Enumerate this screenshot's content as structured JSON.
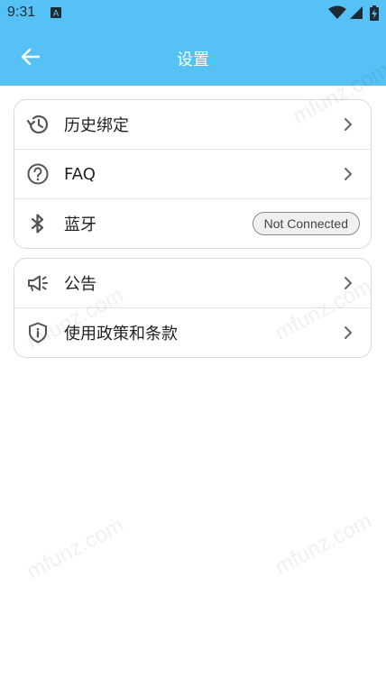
{
  "status_bar": {
    "time": "9:31",
    "app_badge": "A"
  },
  "header": {
    "title": "设置"
  },
  "groups": [
    {
      "items": [
        {
          "label": "历史绑定",
          "icon": "history-icon"
        },
        {
          "label": "FAQ",
          "icon": "help-circle-icon"
        },
        {
          "label": "蓝牙",
          "icon": "bluetooth-icon",
          "badge": "Not Connected"
        }
      ]
    },
    {
      "items": [
        {
          "label": "公告",
          "icon": "megaphone-icon"
        },
        {
          "label": "使用政策和条款",
          "icon": "shield-info-icon"
        }
      ]
    }
  ],
  "watermark": "mfunz.com",
  "colors": {
    "header": "#56c1f5",
    "card_border": "#d9d9d9",
    "icon": "#555555"
  }
}
